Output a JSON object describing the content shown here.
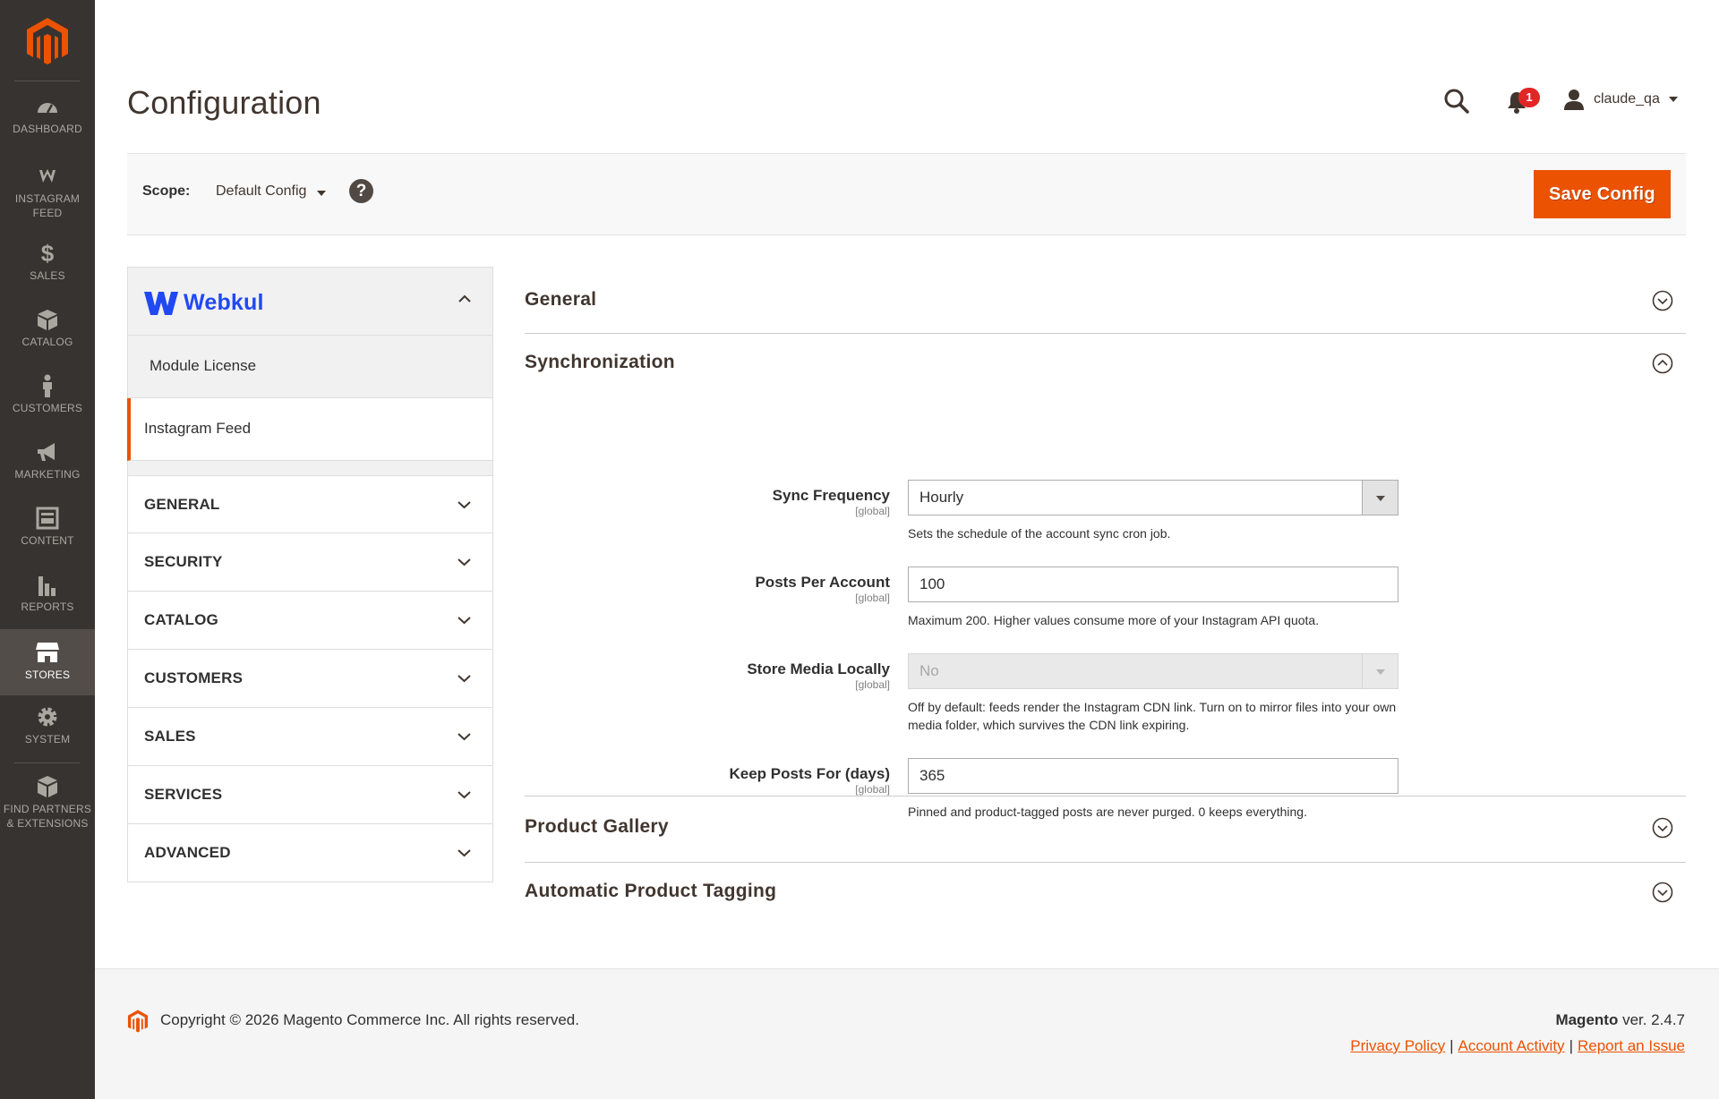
{
  "nav": {
    "items": [
      {
        "label": "DASHBOARD",
        "icon": "dashboard-icon"
      },
      {
        "label": "INSTAGRAM FEED",
        "icon": "instagram-feed-icon"
      },
      {
        "label": "SALES",
        "icon": "dollar-icon"
      },
      {
        "label": "CATALOG",
        "icon": "box-icon"
      },
      {
        "label": "CUSTOMERS",
        "icon": "person-icon"
      },
      {
        "label": "MARKETING",
        "icon": "megaphone-icon"
      },
      {
        "label": "CONTENT",
        "icon": "layout-icon"
      },
      {
        "label": "REPORTS",
        "icon": "bar-chart-icon"
      },
      {
        "label": "STORES",
        "icon": "storefront-icon"
      },
      {
        "label": "SYSTEM",
        "icon": "gear-icon"
      },
      {
        "label": "FIND PARTNERS & EXTENSIONS",
        "icon": "extensions-icon"
      }
    ],
    "active": "STORES"
  },
  "header": {
    "title": "Configuration",
    "notifications_count": "1",
    "username": "claude_qa"
  },
  "scope": {
    "label": "Scope:",
    "value": "Default Config",
    "help": "?",
    "save_label": "Save Config"
  },
  "tabs": {
    "vendor": "Webkul",
    "sub_items": [
      "Module License",
      "Instagram Feed"
    ],
    "active_sub_item": "Instagram Feed",
    "sections": [
      "GENERAL",
      "SECURITY",
      "CATALOG",
      "CUSTOMERS",
      "SALES",
      "SERVICES",
      "ADVANCED"
    ]
  },
  "groups": {
    "general": "General",
    "synchronization": "Synchronization",
    "product_gallery": "Product Gallery",
    "automatic_tagging": "Automatic Product Tagging"
  },
  "fields": {
    "sync_frequency": {
      "label": "Sync Frequency",
      "scope": "[global]",
      "value": "Hourly",
      "note": "Sets the schedule of the account sync cron job."
    },
    "posts_per_account": {
      "label": "Posts Per Account",
      "scope": "[global]",
      "value": "100",
      "note": "Maximum 200. Higher values consume more of your Instagram API quota."
    },
    "store_media_locally": {
      "label": "Store Media Locally",
      "scope": "[global]",
      "value": "No",
      "disabled": true,
      "note": "Off by default: feeds render the Instagram CDN link. Turn on to mirror files into your own media folder, which survives the CDN link expiring."
    },
    "keep_posts_for": {
      "label": "Keep Posts For (days)",
      "scope": "[global]",
      "value": "365",
      "note": "Pinned and product-tagged posts are never purged. 0 keeps everything."
    }
  },
  "footer": {
    "copyright": "Copyright © 2026 Magento Commerce Inc. All rights reserved.",
    "brand": "Magento",
    "version": "ver. 2.4.7",
    "links": [
      "Privacy Policy",
      "Account Activity",
      "Report an Issue"
    ]
  },
  "colors": {
    "accent": "#eb5202",
    "nav_bg": "#373330",
    "nav_active": "#524d49",
    "webkul_blue": "#2149f3",
    "badge_red": "#e22626"
  }
}
